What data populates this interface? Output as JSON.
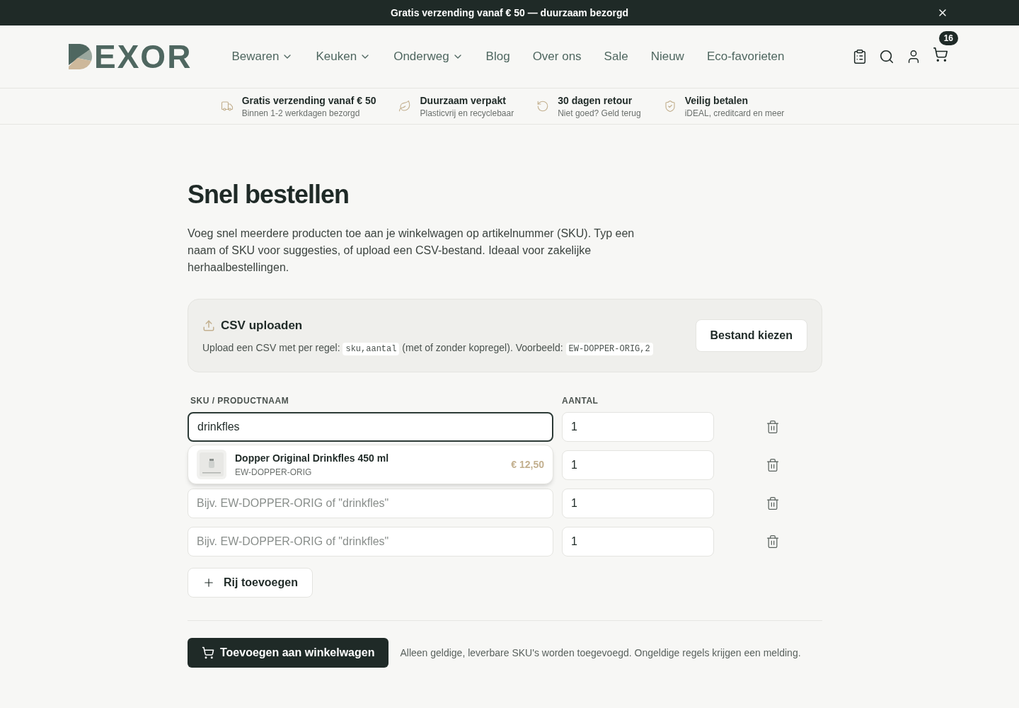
{
  "announcement": {
    "text": "Gratis verzending vanaf € 50 — duurzaam bezorgd"
  },
  "logo": {
    "text": "EXOR"
  },
  "nav": [
    {
      "label": "Bewaren",
      "has_menu": true
    },
    {
      "label": "Keuken",
      "has_menu": true
    },
    {
      "label": "Onderweg",
      "has_menu": true
    },
    {
      "label": "Blog",
      "has_menu": false
    },
    {
      "label": "Over ons",
      "has_menu": false
    },
    {
      "label": "Sale",
      "has_menu": false
    },
    {
      "label": "Nieuw",
      "has_menu": false
    },
    {
      "label": "Eco-favorieten",
      "has_menu": false
    }
  ],
  "cart": {
    "count": "16"
  },
  "usps": [
    {
      "kind": "truck",
      "title": "Gratis verzending vanaf € 50",
      "subtitle": "Binnen 1-2 werkdagen bezorgd"
    },
    {
      "kind": "leaf",
      "title": "Duurzaam verpakt",
      "subtitle": "Plasticvrij en recyclebaar"
    },
    {
      "kind": "return",
      "title": "30 dagen retour",
      "subtitle": "Niet goed? Geld terug"
    },
    {
      "kind": "shield",
      "title": "Veilig betalen",
      "subtitle": "iDEAL, creditcard en meer"
    }
  ],
  "title": "Snel bestellen",
  "intro": "Voeg snel meerdere producten toe aan je winkelwagen op artikelnummer (SKU). Typ een naam of SKU voor suggesties, of upload een CSV-bestand. Ideaal voor zakelijke herhaalbestellingen.",
  "csv": {
    "title": "CSV uploaden",
    "text_before": "Upload een CSV met per regel:",
    "code_format": "sku,aantal",
    "text_middle": "(met of zonder kopregel). Voorbeeld:",
    "code_example": "EW-DOPPER-ORIG,2",
    "button": "Bestand kiezen"
  },
  "columns": [
    "SKU / PRODUCTNAAM",
    "AANTAL"
  ],
  "rows": [
    {
      "sku": "drinkfles",
      "focused": true,
      "quantity": "1"
    },
    {
      "quantity": "1"
    },
    {
      "placeholder": "Bijv. EW-DOPPER-ORIG of \"drinkfles\"",
      "focused": false,
      "quantity": "1"
    },
    {
      "placeholder": "Bijv. EW-DOPPER-ORIG of \"drinkfles\"",
      "focused": false,
      "quantity": "1"
    }
  ],
  "suggestion": {
    "name": "Dopper Original Drinkfles 450 ml",
    "sku": "EW-DOPPER-ORIG",
    "price": "€ 12,50"
  },
  "add_row": "Rij toevoegen",
  "submit": {
    "label": "Toevoegen aan winkelwagen",
    "note": "Alleen geldige, leverbare SKU's worden toegevoegd. Ongeldige regels krijgen een melding."
  }
}
